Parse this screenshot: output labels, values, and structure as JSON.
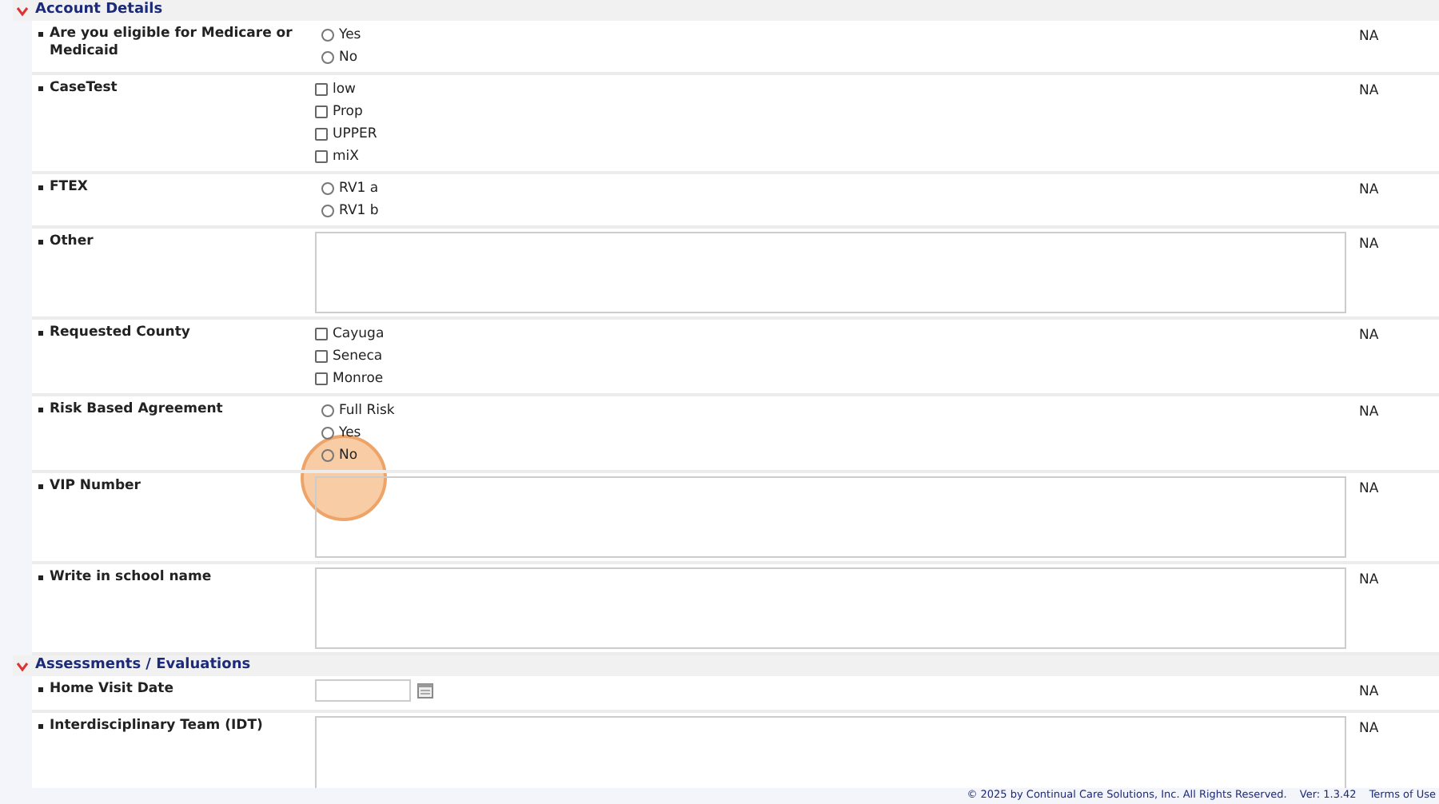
{
  "sections": [
    {
      "title": "Account Details",
      "expanded": true,
      "fields": [
        {
          "label": "Are you eligible for Medicare or Medicaid",
          "kind": "radio",
          "options": [
            {
              "label": "Yes",
              "selected": false
            },
            {
              "label": "No",
              "selected": false
            }
          ],
          "status": "NA"
        },
        {
          "label": "CaseTest",
          "kind": "checkbox",
          "options": [
            {
              "label": "low",
              "checked": false
            },
            {
              "label": "Prop",
              "checked": false
            },
            {
              "label": "UPPER",
              "checked": false
            },
            {
              "label": "miX",
              "checked": false
            }
          ],
          "status": "NA"
        },
        {
          "label": "FTEX",
          "kind": "radio",
          "options": [
            {
              "label": "RV1 a",
              "selected": false
            },
            {
              "label": "RV1 b",
              "selected": false
            }
          ],
          "status": "NA"
        },
        {
          "label": "Other",
          "kind": "textarea",
          "status": "NA"
        },
        {
          "label": "Requested County",
          "kind": "checkbox",
          "options": [
            {
              "label": "Cayuga",
              "checked": false
            },
            {
              "label": "Seneca",
              "checked": false
            },
            {
              "label": "Monroe",
              "checked": false
            }
          ],
          "status": "NA"
        },
        {
          "label": "Risk Based Agreement",
          "kind": "radio",
          "options": [
            {
              "label": "Full Risk",
              "selected": false
            },
            {
              "label": "Yes",
              "selected": false
            },
            {
              "label": "No",
              "selected": false
            }
          ],
          "status": "NA"
        },
        {
          "label": "VIP Number",
          "kind": "textarea",
          "status": "NA"
        },
        {
          "label": "Write in school name",
          "kind": "textarea",
          "status": "NA"
        }
      ]
    },
    {
      "title": "Assessments / Evaluations",
      "expanded": true,
      "fields": [
        {
          "label": "Home Visit Date",
          "kind": "date",
          "status": "NA"
        },
        {
          "label": "Interdisciplinary Team (IDT)",
          "kind": "textarea",
          "status": "NA"
        }
      ]
    }
  ],
  "footer": {
    "copyright": "© 2025 by Continual Care Solutions, Inc. All Rights Reserved.",
    "version": "Ver: 1.3.42",
    "terms_link": "Terms of Use"
  }
}
